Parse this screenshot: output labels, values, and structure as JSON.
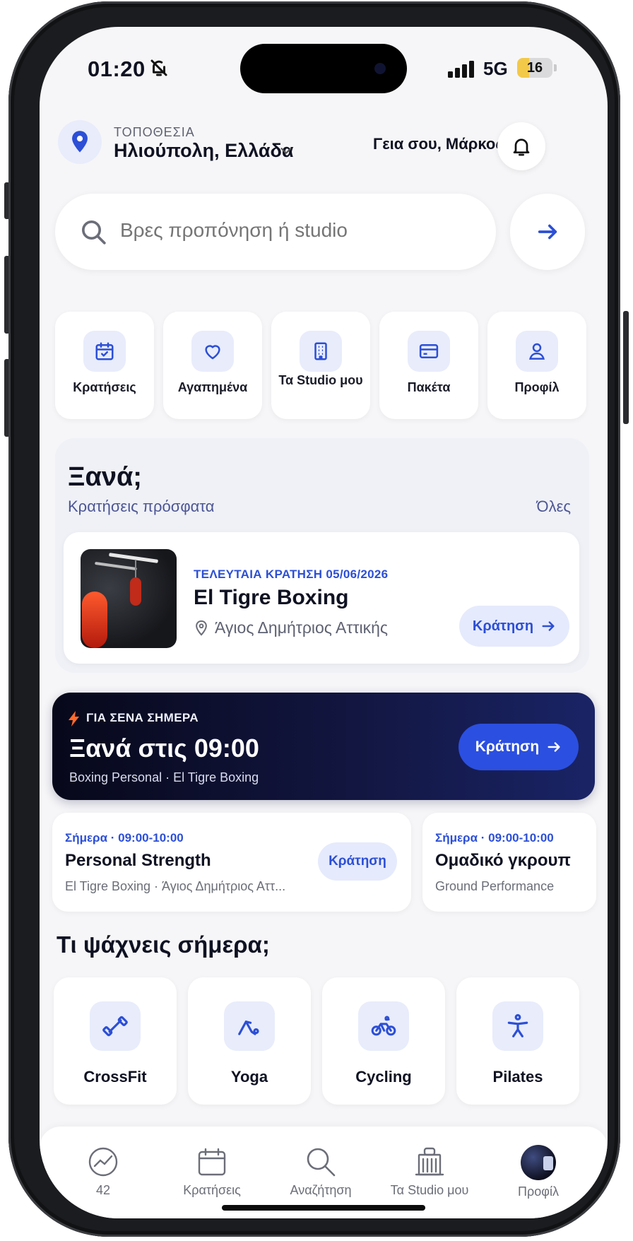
{
  "status_bar": {
    "time": "01:20",
    "network": "5G",
    "battery": "16"
  },
  "header": {
    "location_label": "ΤΟΠΟΘΕΣΙΑ",
    "location_city": "Ηλιούπολη, Ελλάδα",
    "greeting": "Γεια σου, Μάρκος"
  },
  "search": {
    "placeholder": "Βρες προπόνηση ή studio"
  },
  "quick_actions": [
    {
      "label": "Κρατήσεις",
      "icon": "calendar-check-icon"
    },
    {
      "label": "Αγαπημένα",
      "icon": "heart-icon"
    },
    {
      "label": "Τα Studio μου",
      "icon": "building-icon"
    },
    {
      "label": "Πακέτα",
      "icon": "credit-card-icon"
    },
    {
      "label": "Προφίλ",
      "icon": "user-icon"
    }
  ],
  "recent": {
    "title": "Ξανά;",
    "subtitle": "Κρατήσεις πρόσφατα",
    "all_link": "Όλες",
    "card": {
      "last_booking": "ΤΕΛΕΥΤΑΙΑ ΚΡΑΤΗΣΗ 05/06/2026",
      "name": "El Tigre Boxing",
      "address": "Άγιος Δημήτριος Αττικής",
      "button": "Κράτηση"
    }
  },
  "banner": {
    "kicker": "ΓΙΑ ΣΕΝΑ ΣΗΜΕΡΑ",
    "title": "Ξανά στις 09:00",
    "subtitle": "Boxing Personal · El Tigre Boxing",
    "button": "Κράτηση"
  },
  "sessions": [
    {
      "time": "Σήμερα · 09:00-10:00",
      "name": "Personal Strength",
      "place": "El Tigre Boxing · Άγιος Δημήτριος Αττ...",
      "button": "Κράτηση"
    },
    {
      "time": "Σήμερα · 09:00-10:00",
      "name": "Ομαδικό γκρουπ",
      "place": "Ground Performance"
    }
  ],
  "categories": {
    "title": "Τι ψάχνεις σήμερα;",
    "items": [
      {
        "label": "CrossFit",
        "icon": "dumbbell-icon"
      },
      {
        "label": "Yoga",
        "icon": "yoga-icon"
      },
      {
        "label": "Cycling",
        "icon": "bicycle-icon"
      },
      {
        "label": "Pilates",
        "icon": "pilates-icon"
      }
    ]
  },
  "tabbar": [
    {
      "label": "42",
      "icon": "activity-gauge-icon"
    },
    {
      "label": "Κρατήσεις",
      "icon": "calendar-icon"
    },
    {
      "label": "Αναζήτηση",
      "icon": "search-icon"
    },
    {
      "label": "Τα Studio μου",
      "icon": "studio-icon"
    },
    {
      "label": "Προφίλ",
      "icon": "avatar"
    }
  ],
  "colors": {
    "accent": "#2c4fd6",
    "accent_soft": "#e8ecfb",
    "banner_dark": "#07081a"
  }
}
